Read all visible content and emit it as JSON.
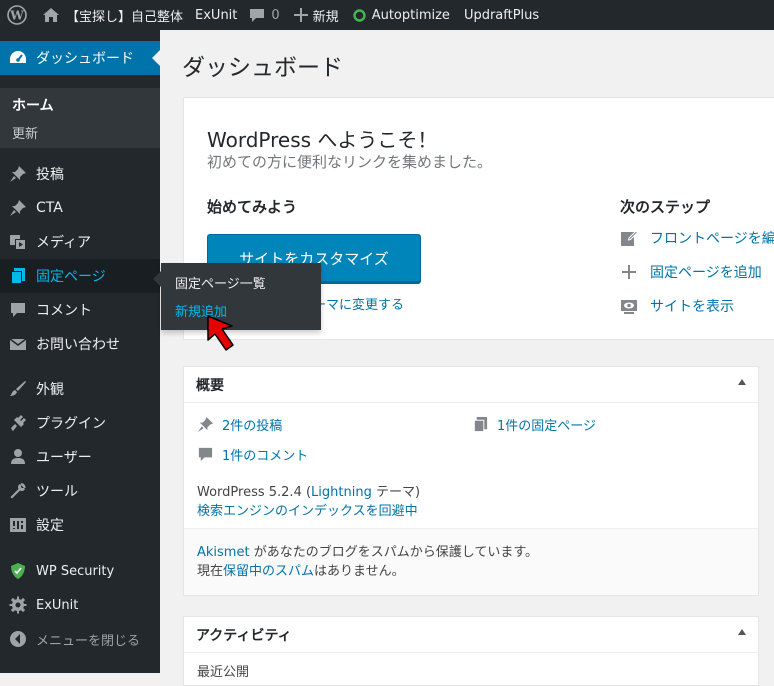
{
  "adminbar": {
    "site_name": "【宝探し】自己整体",
    "exunit": "ExUnit",
    "comments_count": "0",
    "new_label": "新規",
    "autoptimize": "Autoptimize",
    "updraft": "UpdraftPlus"
  },
  "sidebar": {
    "dashboard": "ダッシュボード",
    "home": "ホーム",
    "updates": "更新",
    "posts": "投稿",
    "cta": "CTA",
    "media": "メディア",
    "pages": "固定ページ",
    "comments": "コメント",
    "contact": "お問い合わせ",
    "appearance": "外観",
    "plugins": "プラグイン",
    "users": "ユーザー",
    "tools": "ツール",
    "settings": "設定",
    "wp_security": "WP Security",
    "exunit": "ExUnit",
    "collapse": "メニューを閉じる"
  },
  "flyout": {
    "all_pages": "固定ページ一覧",
    "add_new": "新規追加"
  },
  "page_title": "ダッシュボード",
  "welcome": {
    "title": "WordPress へようこそ！",
    "subtitle": "初めての方に便利なリンクを集めました。",
    "get_started": "始めてみよう",
    "customize_button": "サイトをカスタマイズ",
    "theme_link": "テーマに変更する",
    "next_steps": "次のステップ",
    "front_page": "フロントページを編",
    "add_page": "固定ページを追加",
    "view_site": "サイトを表示"
  },
  "glance": {
    "title": "概要",
    "posts": "2件の投稿",
    "pages": "1件の固定ページ",
    "comments": "1件のコメント",
    "version_prefix": "WordPress 5.2.4 (",
    "theme_name": "Lightning",
    "version_suffix": " テーマ)",
    "search_engine": "検索エンジンのインデックスを回避中",
    "akismet_name": "Akismet",
    "akismet_text": " があなたのブログをスパムから保護しています。",
    "spam_prefix": "現在",
    "spam_link": "保留中のスパム",
    "spam_suffix": "はありません。"
  },
  "activity": {
    "title": "アクティビティ",
    "recent": "最近公開"
  }
}
